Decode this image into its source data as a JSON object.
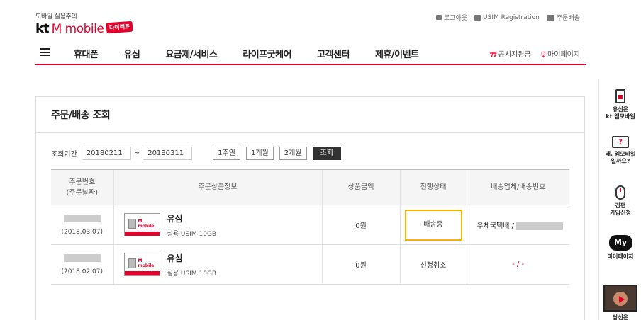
{
  "logo": {
    "slogan": "모바일 실용주의",
    "kt": "kt",
    "mobile": "M mobile",
    "badge": "다이렉트"
  },
  "util_links": [
    {
      "label": "로그아웃",
      "icon": "lock-icon"
    },
    {
      "label": "USIM Registration",
      "icon": "card-icon"
    },
    {
      "label": "주문배송",
      "icon": "truck-icon"
    }
  ],
  "nav": {
    "items": [
      "휴대폰",
      "유심",
      "요금제/서비스",
      "라이프굿케어",
      "고객센터",
      "제휴/이벤트"
    ],
    "support_symbol": "₩",
    "support_label": "공시지원금",
    "mypage_symbol": "♀",
    "mypage_label": "마이페이지"
  },
  "panel": {
    "title": "주문/배송 조회",
    "search": {
      "label": "조회기간",
      "start_date": "20180211",
      "tilde": "~",
      "end_date": "20180311",
      "periods": [
        "1주일",
        "1개월",
        "2개월"
      ],
      "search_button": "조회"
    },
    "table": {
      "headers": {
        "order_no_line1": "주문번호",
        "order_no_line2": "(주문날짜)",
        "product": "주문상품정보",
        "amount": "상품금액",
        "status": "진행상태",
        "carrier": "배송업체/배송번호"
      },
      "rows": [
        {
          "date": "(2018.03.07)",
          "product_name": "유심",
          "product_desc": "실용 USIM 10GB",
          "thumb_brand": "M mobile",
          "amount": "0원",
          "status": "배송중",
          "carrier": "우체국택배 /"
        },
        {
          "date": "(2018.02.07)",
          "product_name": "유심",
          "product_desc": "실용 USIM 10GB",
          "thumb_brand": "M mobile",
          "amount": "0원",
          "status": "신청취소",
          "carrier": "- / -"
        }
      ]
    }
  },
  "quick_menu": {
    "items": [
      {
        "line1": "유심은",
        "line2": "kt 엠모바일"
      },
      {
        "icon_text": "?",
        "line1": "왜, 엠모바일",
        "line2": "일까요?"
      },
      {
        "line1": "간편",
        "line2": "가입신청"
      },
      {
        "icon_text": "My",
        "line1": "마이페이지"
      },
      {
        "line1": "당신은"
      }
    ]
  },
  "colors": {
    "brand_red": "#e5002b",
    "highlight": "#f4b400"
  }
}
